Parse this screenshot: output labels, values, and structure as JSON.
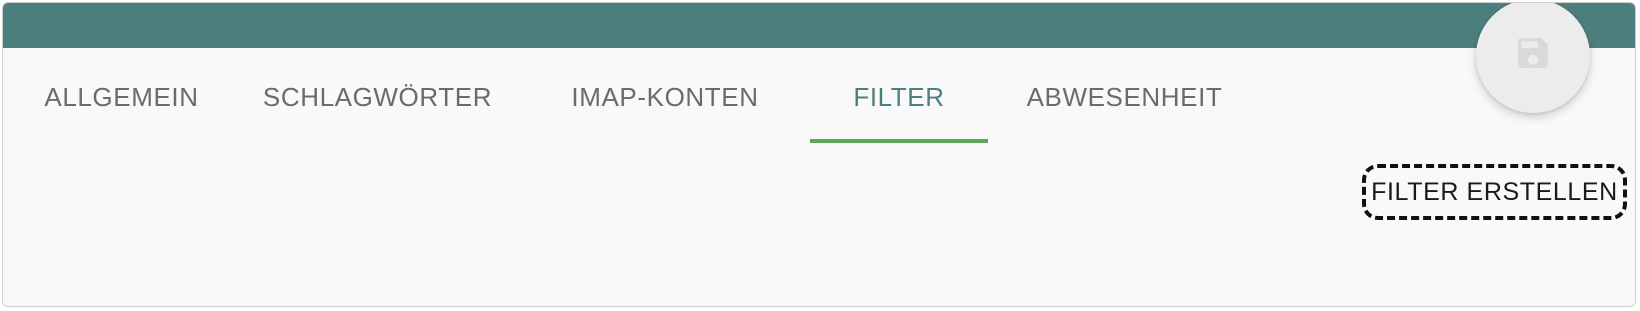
{
  "tabs": [
    {
      "label": "ALLGEMEIN"
    },
    {
      "label": "SCHLAGWÖRTER"
    },
    {
      "label": "IMAP-KONTEN"
    },
    {
      "label": "FILTER",
      "active": true
    },
    {
      "label": "ABWESENHEIT"
    }
  ],
  "actions": {
    "create_filter_label": "FILTER ERSTELLEN",
    "save_icon": "save-icon"
  },
  "colors": {
    "header": "#4e7f7f",
    "active_tab_text": "#4e7f7f",
    "tab_indicator": "#5fa85a",
    "inactive_tab_text": "#6b6b6b",
    "background": "#f9f9f9"
  }
}
